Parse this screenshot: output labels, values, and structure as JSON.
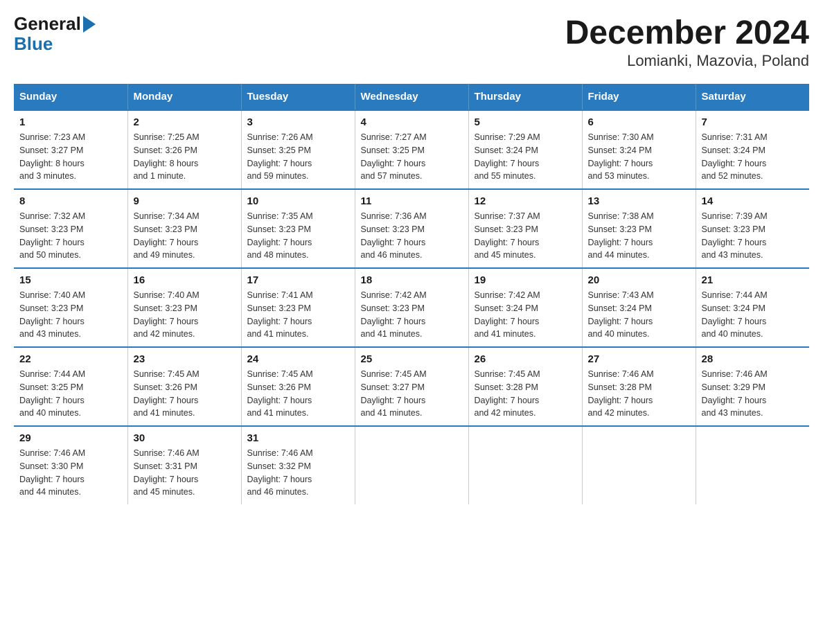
{
  "logo": {
    "general": "General",
    "blue": "Blue"
  },
  "title": "December 2024",
  "subtitle": "Lomianki, Mazovia, Poland",
  "days_of_week": [
    "Sunday",
    "Monday",
    "Tuesday",
    "Wednesday",
    "Thursday",
    "Friday",
    "Saturday"
  ],
  "weeks": [
    [
      {
        "day": "1",
        "sunrise": "Sunrise: 7:23 AM",
        "sunset": "Sunset: 3:27 PM",
        "daylight": "Daylight: 8 hours",
        "daylight2": "and 3 minutes."
      },
      {
        "day": "2",
        "sunrise": "Sunrise: 7:25 AM",
        "sunset": "Sunset: 3:26 PM",
        "daylight": "Daylight: 8 hours",
        "daylight2": "and 1 minute."
      },
      {
        "day": "3",
        "sunrise": "Sunrise: 7:26 AM",
        "sunset": "Sunset: 3:25 PM",
        "daylight": "Daylight: 7 hours",
        "daylight2": "and 59 minutes."
      },
      {
        "day": "4",
        "sunrise": "Sunrise: 7:27 AM",
        "sunset": "Sunset: 3:25 PM",
        "daylight": "Daylight: 7 hours",
        "daylight2": "and 57 minutes."
      },
      {
        "day": "5",
        "sunrise": "Sunrise: 7:29 AM",
        "sunset": "Sunset: 3:24 PM",
        "daylight": "Daylight: 7 hours",
        "daylight2": "and 55 minutes."
      },
      {
        "day": "6",
        "sunrise": "Sunrise: 7:30 AM",
        "sunset": "Sunset: 3:24 PM",
        "daylight": "Daylight: 7 hours",
        "daylight2": "and 53 minutes."
      },
      {
        "day": "7",
        "sunrise": "Sunrise: 7:31 AM",
        "sunset": "Sunset: 3:24 PM",
        "daylight": "Daylight: 7 hours",
        "daylight2": "and 52 minutes."
      }
    ],
    [
      {
        "day": "8",
        "sunrise": "Sunrise: 7:32 AM",
        "sunset": "Sunset: 3:23 PM",
        "daylight": "Daylight: 7 hours",
        "daylight2": "and 50 minutes."
      },
      {
        "day": "9",
        "sunrise": "Sunrise: 7:34 AM",
        "sunset": "Sunset: 3:23 PM",
        "daylight": "Daylight: 7 hours",
        "daylight2": "and 49 minutes."
      },
      {
        "day": "10",
        "sunrise": "Sunrise: 7:35 AM",
        "sunset": "Sunset: 3:23 PM",
        "daylight": "Daylight: 7 hours",
        "daylight2": "and 48 minutes."
      },
      {
        "day": "11",
        "sunrise": "Sunrise: 7:36 AM",
        "sunset": "Sunset: 3:23 PM",
        "daylight": "Daylight: 7 hours",
        "daylight2": "and 46 minutes."
      },
      {
        "day": "12",
        "sunrise": "Sunrise: 7:37 AM",
        "sunset": "Sunset: 3:23 PM",
        "daylight": "Daylight: 7 hours",
        "daylight2": "and 45 minutes."
      },
      {
        "day": "13",
        "sunrise": "Sunrise: 7:38 AM",
        "sunset": "Sunset: 3:23 PM",
        "daylight": "Daylight: 7 hours",
        "daylight2": "and 44 minutes."
      },
      {
        "day": "14",
        "sunrise": "Sunrise: 7:39 AM",
        "sunset": "Sunset: 3:23 PM",
        "daylight": "Daylight: 7 hours",
        "daylight2": "and 43 minutes."
      }
    ],
    [
      {
        "day": "15",
        "sunrise": "Sunrise: 7:40 AM",
        "sunset": "Sunset: 3:23 PM",
        "daylight": "Daylight: 7 hours",
        "daylight2": "and 43 minutes."
      },
      {
        "day": "16",
        "sunrise": "Sunrise: 7:40 AM",
        "sunset": "Sunset: 3:23 PM",
        "daylight": "Daylight: 7 hours",
        "daylight2": "and 42 minutes."
      },
      {
        "day": "17",
        "sunrise": "Sunrise: 7:41 AM",
        "sunset": "Sunset: 3:23 PM",
        "daylight": "Daylight: 7 hours",
        "daylight2": "and 41 minutes."
      },
      {
        "day": "18",
        "sunrise": "Sunrise: 7:42 AM",
        "sunset": "Sunset: 3:23 PM",
        "daylight": "Daylight: 7 hours",
        "daylight2": "and 41 minutes."
      },
      {
        "day": "19",
        "sunrise": "Sunrise: 7:42 AM",
        "sunset": "Sunset: 3:24 PM",
        "daylight": "Daylight: 7 hours",
        "daylight2": "and 41 minutes."
      },
      {
        "day": "20",
        "sunrise": "Sunrise: 7:43 AM",
        "sunset": "Sunset: 3:24 PM",
        "daylight": "Daylight: 7 hours",
        "daylight2": "and 40 minutes."
      },
      {
        "day": "21",
        "sunrise": "Sunrise: 7:44 AM",
        "sunset": "Sunset: 3:24 PM",
        "daylight": "Daylight: 7 hours",
        "daylight2": "and 40 minutes."
      }
    ],
    [
      {
        "day": "22",
        "sunrise": "Sunrise: 7:44 AM",
        "sunset": "Sunset: 3:25 PM",
        "daylight": "Daylight: 7 hours",
        "daylight2": "and 40 minutes."
      },
      {
        "day": "23",
        "sunrise": "Sunrise: 7:45 AM",
        "sunset": "Sunset: 3:26 PM",
        "daylight": "Daylight: 7 hours",
        "daylight2": "and 41 minutes."
      },
      {
        "day": "24",
        "sunrise": "Sunrise: 7:45 AM",
        "sunset": "Sunset: 3:26 PM",
        "daylight": "Daylight: 7 hours",
        "daylight2": "and 41 minutes."
      },
      {
        "day": "25",
        "sunrise": "Sunrise: 7:45 AM",
        "sunset": "Sunset: 3:27 PM",
        "daylight": "Daylight: 7 hours",
        "daylight2": "and 41 minutes."
      },
      {
        "day": "26",
        "sunrise": "Sunrise: 7:45 AM",
        "sunset": "Sunset: 3:28 PM",
        "daylight": "Daylight: 7 hours",
        "daylight2": "and 42 minutes."
      },
      {
        "day": "27",
        "sunrise": "Sunrise: 7:46 AM",
        "sunset": "Sunset: 3:28 PM",
        "daylight": "Daylight: 7 hours",
        "daylight2": "and 42 minutes."
      },
      {
        "day": "28",
        "sunrise": "Sunrise: 7:46 AM",
        "sunset": "Sunset: 3:29 PM",
        "daylight": "Daylight: 7 hours",
        "daylight2": "and 43 minutes."
      }
    ],
    [
      {
        "day": "29",
        "sunrise": "Sunrise: 7:46 AM",
        "sunset": "Sunset: 3:30 PM",
        "daylight": "Daylight: 7 hours",
        "daylight2": "and 44 minutes."
      },
      {
        "day": "30",
        "sunrise": "Sunrise: 7:46 AM",
        "sunset": "Sunset: 3:31 PM",
        "daylight": "Daylight: 7 hours",
        "daylight2": "and 45 minutes."
      },
      {
        "day": "31",
        "sunrise": "Sunrise: 7:46 AM",
        "sunset": "Sunset: 3:32 PM",
        "daylight": "Daylight: 7 hours",
        "daylight2": "and 46 minutes."
      },
      null,
      null,
      null,
      null
    ]
  ]
}
